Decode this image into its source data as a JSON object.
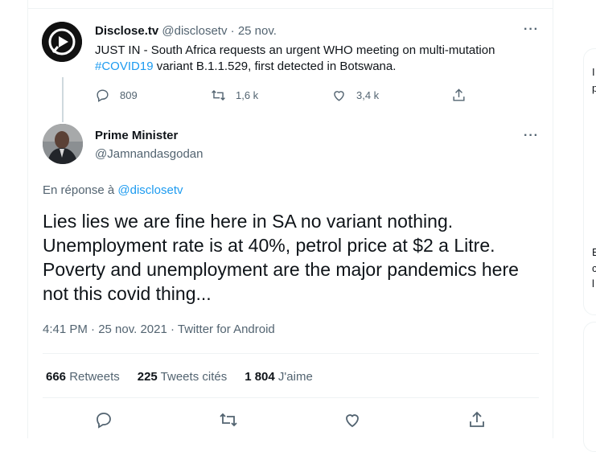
{
  "parent_tweet": {
    "display_name": "Disclose.tv",
    "handle": "@disclosetv",
    "separator": "·",
    "date": "25 nov.",
    "text_before": "JUST IN - South Africa requests an urgent WHO meeting on multi-mutation ",
    "hashtag": "#COVID19",
    "text_after": " variant B.1.1.529, first detected in Botswana.",
    "replies": "809",
    "retweets": "1,6 k",
    "likes": "3,4 k",
    "more": "···"
  },
  "main_tweet": {
    "display_name": "Prime Minister",
    "handle": "@Jamnandasgodan",
    "reply_prefix": "En réponse à ",
    "reply_to": "@disclosetv",
    "text": "Lies lies we are fine here in SA no variant nothing. Unemployment rate is at 40%, petrol price at $2 a Litre. Poverty and unemployment are the major pandemics here not this covid thing...",
    "meta": "4:41 PM · 25 nov. 2021 · Twitter for Android",
    "more": "···",
    "stats": {
      "retweets_count": "666",
      "retweets_label": "Retweets",
      "quotes_count": "225",
      "quotes_label": "Tweets cités",
      "likes_count": "1 804",
      "likes_label": "J'aime"
    }
  },
  "sidebar_fragments": [
    "I",
    "p",
    "E",
    "c",
    "l"
  ],
  "colors": {
    "accent": "#1d9bf0",
    "muted": "#536471",
    "border": "#eff3f4"
  },
  "icons": [
    "disclosetv-logo-icon",
    "reply-icon",
    "retweet-icon",
    "like-icon",
    "share-icon",
    "more-icon"
  ]
}
